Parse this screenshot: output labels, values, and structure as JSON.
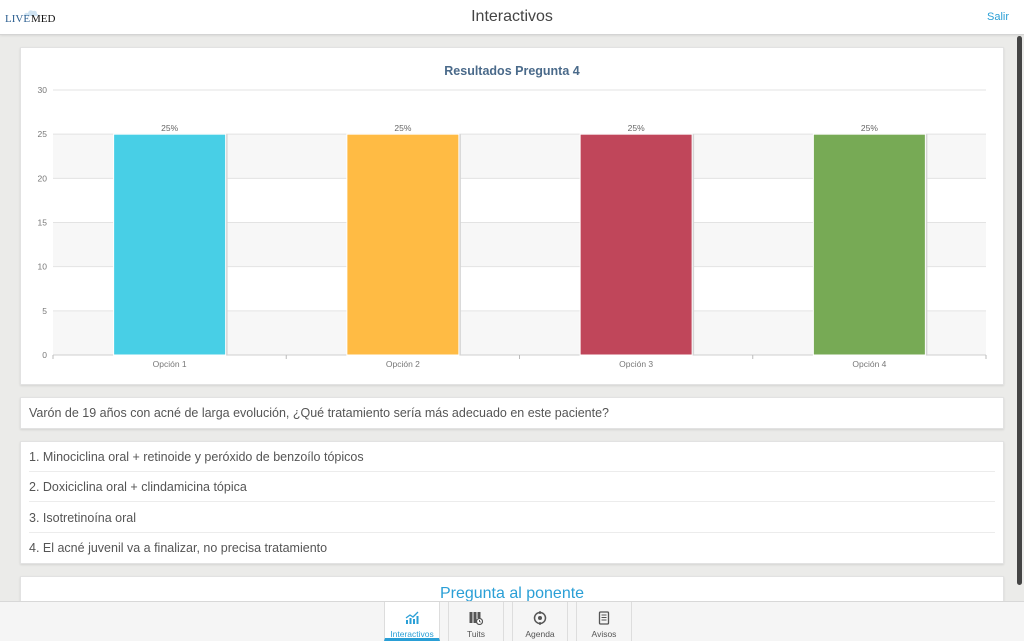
{
  "header": {
    "logo_live": "LIVE",
    "logo_med": "MED",
    "title": "Interactivos",
    "logout_label": "Salir"
  },
  "chart_data": {
    "type": "bar",
    "title": "Resultados Pregunta 4",
    "categories": [
      "Opción 1",
      "Opción 2",
      "Opción 3",
      "Opción 4"
    ],
    "values": [
      25,
      25,
      25,
      25
    ],
    "data_labels": [
      "25%",
      "25%",
      "25%",
      "25%"
    ],
    "colors": [
      "#48cfe6",
      "#ffbb44",
      "#c0465a",
      "#77aa55"
    ],
    "ylim": [
      0,
      30
    ],
    "yticks": [
      0,
      5,
      10,
      15,
      20,
      25,
      30
    ],
    "grid": true
  },
  "question": {
    "text": "Varón de 19 años con acné de larga evolución, ¿Qué tratamiento sería más adecuado en este paciente?"
  },
  "options": [
    "1. Minociclina oral + retinoide y peróxido de benzoílo tópicos",
    "2. Doxiciclina oral + clindamicina tópica",
    "3. Isotretinoína oral",
    "4. El acné juvenil va a finalizar, no precisa tratamiento"
  ],
  "ask_speaker": {
    "label": "Pregunta al ponente"
  },
  "tabs": [
    {
      "label": "Interactivos",
      "icon": "chart-icon",
      "active": true
    },
    {
      "label": "Tuits",
      "icon": "tweets-icon",
      "active": false
    },
    {
      "label": "Agenda",
      "icon": "agenda-icon",
      "active": false
    },
    {
      "label": "Avisos",
      "icon": "notices-icon",
      "active": false
    }
  ],
  "colors": {
    "accent": "#2a9fd6",
    "chart_title": "#4a6a8a"
  }
}
